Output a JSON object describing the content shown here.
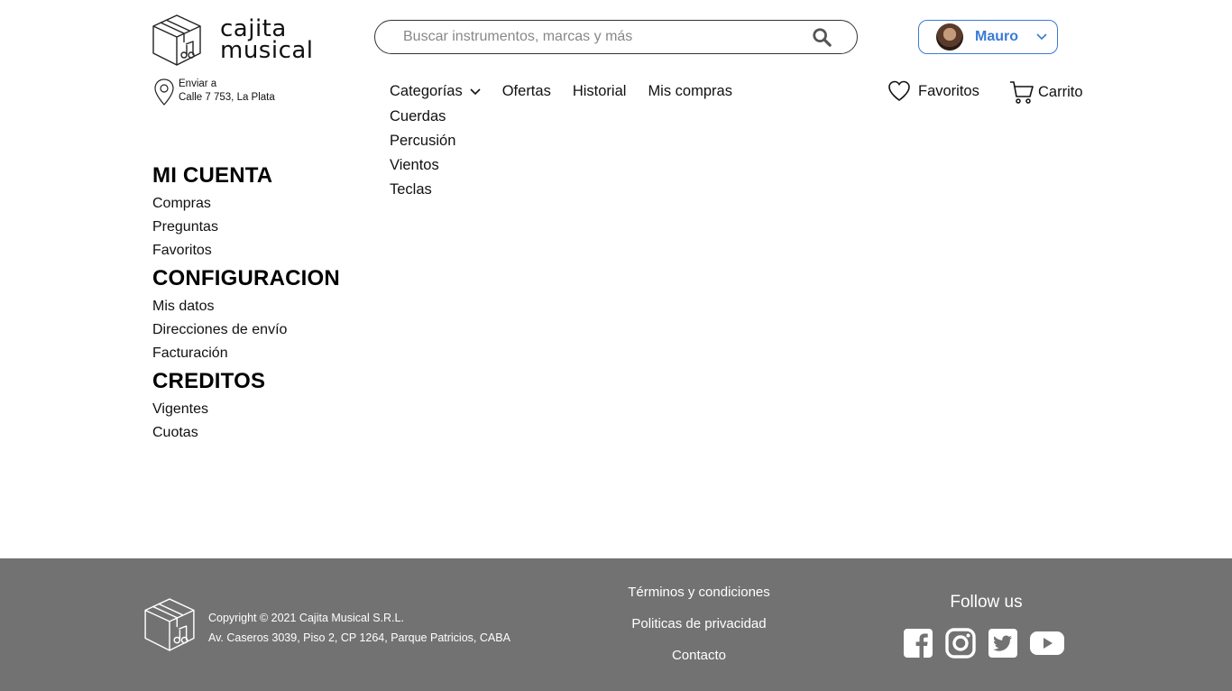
{
  "brand": {
    "line1": "cajita",
    "line2": "musical"
  },
  "search": {
    "placeholder": "Buscar instrumentos, marcas y más"
  },
  "user": {
    "name": "Mauro"
  },
  "shipping": {
    "label": "Enviar a",
    "address": "Calle 7 753, La Plata"
  },
  "nav": {
    "categories": "Categorías",
    "offers": "Ofertas",
    "history": "Historial",
    "purchases": "Mis compras",
    "favorites": "Favoritos",
    "cart": "Carrito"
  },
  "categories_menu": [
    "Cuerdas",
    "Percusión",
    "Vientos",
    "Teclas"
  ],
  "sidebar": {
    "account": {
      "title": "MI CUENTA",
      "items": [
        "Compras",
        "Preguntas",
        "Favoritos"
      ]
    },
    "config": {
      "title": "CONFIGURACION",
      "items": [
        "Mis datos",
        "Direcciones de envío",
        "Facturación"
      ]
    },
    "credits": {
      "title": "CREDITOS",
      "items": [
        "Vigentes",
        "Cuotas"
      ]
    }
  },
  "footer": {
    "copyright": "Copyright © 2021 Cajita Musical S.R.L.",
    "address": "Av. Caseros 3039, Piso 2, CP 1264, Parque Patricios, CABA",
    "links": [
      "Términos y condiciones",
      "Politicas de privacidad",
      "Contacto"
    ],
    "follow": "Follow us",
    "socials": [
      "facebook-icon",
      "instagram-icon",
      "twitter-icon",
      "youtube-icon"
    ]
  },
  "colors": {
    "accent": "#3a7bd5",
    "footer_bg": "#727272"
  }
}
